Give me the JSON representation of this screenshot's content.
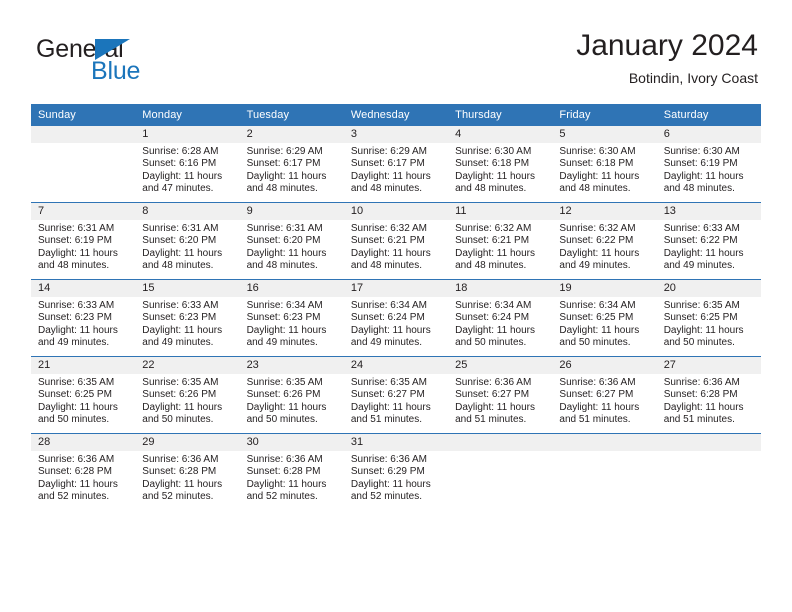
{
  "brand": {
    "word_top": "General",
    "word_bottom": "Blue",
    "triangle_color": "#1b75bb",
    "text_color": "#231f20"
  },
  "header": {
    "title": "January 2024",
    "subtitle": "Botindin, Ivory Coast"
  },
  "theme": {
    "header_blue": "#2f74b5",
    "band_gray": "#f0f0f0",
    "text": "#231f20"
  },
  "labels": {
    "sunrise_prefix": "Sunrise:",
    "sunset_prefix": "Sunset:",
    "daylight_prefix": "Daylight:"
  },
  "weekdays": [
    "Sunday",
    "Monday",
    "Tuesday",
    "Wednesday",
    "Thursday",
    "Friday",
    "Saturday"
  ],
  "weeks": [
    [
      {
        "day": "",
        "empty": true,
        "sunrise": "",
        "sunset": "",
        "daylight_1": "",
        "daylight_2": ""
      },
      {
        "day": "1",
        "sunrise": "Sunrise: 6:28 AM",
        "sunset": "Sunset: 6:16 PM",
        "daylight_1": "Daylight: 11 hours",
        "daylight_2": "and 47 minutes."
      },
      {
        "day": "2",
        "sunrise": "Sunrise: 6:29 AM",
        "sunset": "Sunset: 6:17 PM",
        "daylight_1": "Daylight: 11 hours",
        "daylight_2": "and 48 minutes."
      },
      {
        "day": "3",
        "sunrise": "Sunrise: 6:29 AM",
        "sunset": "Sunset: 6:17 PM",
        "daylight_1": "Daylight: 11 hours",
        "daylight_2": "and 48 minutes."
      },
      {
        "day": "4",
        "sunrise": "Sunrise: 6:30 AM",
        "sunset": "Sunset: 6:18 PM",
        "daylight_1": "Daylight: 11 hours",
        "daylight_2": "and 48 minutes."
      },
      {
        "day": "5",
        "sunrise": "Sunrise: 6:30 AM",
        "sunset": "Sunset: 6:18 PM",
        "daylight_1": "Daylight: 11 hours",
        "daylight_2": "and 48 minutes."
      },
      {
        "day": "6",
        "sunrise": "Sunrise: 6:30 AM",
        "sunset": "Sunset: 6:19 PM",
        "daylight_1": "Daylight: 11 hours",
        "daylight_2": "and 48 minutes."
      }
    ],
    [
      {
        "day": "7",
        "sunrise": "Sunrise: 6:31 AM",
        "sunset": "Sunset: 6:19 PM",
        "daylight_1": "Daylight: 11 hours",
        "daylight_2": "and 48 minutes."
      },
      {
        "day": "8",
        "sunrise": "Sunrise: 6:31 AM",
        "sunset": "Sunset: 6:20 PM",
        "daylight_1": "Daylight: 11 hours",
        "daylight_2": "and 48 minutes."
      },
      {
        "day": "9",
        "sunrise": "Sunrise: 6:31 AM",
        "sunset": "Sunset: 6:20 PM",
        "daylight_1": "Daylight: 11 hours",
        "daylight_2": "and 48 minutes."
      },
      {
        "day": "10",
        "sunrise": "Sunrise: 6:32 AM",
        "sunset": "Sunset: 6:21 PM",
        "daylight_1": "Daylight: 11 hours",
        "daylight_2": "and 48 minutes."
      },
      {
        "day": "11",
        "sunrise": "Sunrise: 6:32 AM",
        "sunset": "Sunset: 6:21 PM",
        "daylight_1": "Daylight: 11 hours",
        "daylight_2": "and 48 minutes."
      },
      {
        "day": "12",
        "sunrise": "Sunrise: 6:32 AM",
        "sunset": "Sunset: 6:22 PM",
        "daylight_1": "Daylight: 11 hours",
        "daylight_2": "and 49 minutes."
      },
      {
        "day": "13",
        "sunrise": "Sunrise: 6:33 AM",
        "sunset": "Sunset: 6:22 PM",
        "daylight_1": "Daylight: 11 hours",
        "daylight_2": "and 49 minutes."
      }
    ],
    [
      {
        "day": "14",
        "sunrise": "Sunrise: 6:33 AM",
        "sunset": "Sunset: 6:23 PM",
        "daylight_1": "Daylight: 11 hours",
        "daylight_2": "and 49 minutes."
      },
      {
        "day": "15",
        "sunrise": "Sunrise: 6:33 AM",
        "sunset": "Sunset: 6:23 PM",
        "daylight_1": "Daylight: 11 hours",
        "daylight_2": "and 49 minutes."
      },
      {
        "day": "16",
        "sunrise": "Sunrise: 6:34 AM",
        "sunset": "Sunset: 6:23 PM",
        "daylight_1": "Daylight: 11 hours",
        "daylight_2": "and 49 minutes."
      },
      {
        "day": "17",
        "sunrise": "Sunrise: 6:34 AM",
        "sunset": "Sunset: 6:24 PM",
        "daylight_1": "Daylight: 11 hours",
        "daylight_2": "and 49 minutes."
      },
      {
        "day": "18",
        "sunrise": "Sunrise: 6:34 AM",
        "sunset": "Sunset: 6:24 PM",
        "daylight_1": "Daylight: 11 hours",
        "daylight_2": "and 50 minutes."
      },
      {
        "day": "19",
        "sunrise": "Sunrise: 6:34 AM",
        "sunset": "Sunset: 6:25 PM",
        "daylight_1": "Daylight: 11 hours",
        "daylight_2": "and 50 minutes."
      },
      {
        "day": "20",
        "sunrise": "Sunrise: 6:35 AM",
        "sunset": "Sunset: 6:25 PM",
        "daylight_1": "Daylight: 11 hours",
        "daylight_2": "and 50 minutes."
      }
    ],
    [
      {
        "day": "21",
        "sunrise": "Sunrise: 6:35 AM",
        "sunset": "Sunset: 6:25 PM",
        "daylight_1": "Daylight: 11 hours",
        "daylight_2": "and 50 minutes."
      },
      {
        "day": "22",
        "sunrise": "Sunrise: 6:35 AM",
        "sunset": "Sunset: 6:26 PM",
        "daylight_1": "Daylight: 11 hours",
        "daylight_2": "and 50 minutes."
      },
      {
        "day": "23",
        "sunrise": "Sunrise: 6:35 AM",
        "sunset": "Sunset: 6:26 PM",
        "daylight_1": "Daylight: 11 hours",
        "daylight_2": "and 50 minutes."
      },
      {
        "day": "24",
        "sunrise": "Sunrise: 6:35 AM",
        "sunset": "Sunset: 6:27 PM",
        "daylight_1": "Daylight: 11 hours",
        "daylight_2": "and 51 minutes."
      },
      {
        "day": "25",
        "sunrise": "Sunrise: 6:36 AM",
        "sunset": "Sunset: 6:27 PM",
        "daylight_1": "Daylight: 11 hours",
        "daylight_2": "and 51 minutes."
      },
      {
        "day": "26",
        "sunrise": "Sunrise: 6:36 AM",
        "sunset": "Sunset: 6:27 PM",
        "daylight_1": "Daylight: 11 hours",
        "daylight_2": "and 51 minutes."
      },
      {
        "day": "27",
        "sunrise": "Sunrise: 6:36 AM",
        "sunset": "Sunset: 6:28 PM",
        "daylight_1": "Daylight: 11 hours",
        "daylight_2": "and 51 minutes."
      }
    ],
    [
      {
        "day": "28",
        "sunrise": "Sunrise: 6:36 AM",
        "sunset": "Sunset: 6:28 PM",
        "daylight_1": "Daylight: 11 hours",
        "daylight_2": "and 52 minutes."
      },
      {
        "day": "29",
        "sunrise": "Sunrise: 6:36 AM",
        "sunset": "Sunset: 6:28 PM",
        "daylight_1": "Daylight: 11 hours",
        "daylight_2": "and 52 minutes."
      },
      {
        "day": "30",
        "sunrise": "Sunrise: 6:36 AM",
        "sunset": "Sunset: 6:28 PM",
        "daylight_1": "Daylight: 11 hours",
        "daylight_2": "and 52 minutes."
      },
      {
        "day": "31",
        "sunrise": "Sunrise: 6:36 AM",
        "sunset": "Sunset: 6:29 PM",
        "daylight_1": "Daylight: 11 hours",
        "daylight_2": "and 52 minutes."
      },
      {
        "day": "",
        "empty": true,
        "sunrise": "",
        "sunset": "",
        "daylight_1": "",
        "daylight_2": ""
      },
      {
        "day": "",
        "empty": true,
        "sunrise": "",
        "sunset": "",
        "daylight_1": "",
        "daylight_2": ""
      },
      {
        "day": "",
        "empty": true,
        "sunrise": "",
        "sunset": "",
        "daylight_1": "",
        "daylight_2": ""
      }
    ]
  ]
}
